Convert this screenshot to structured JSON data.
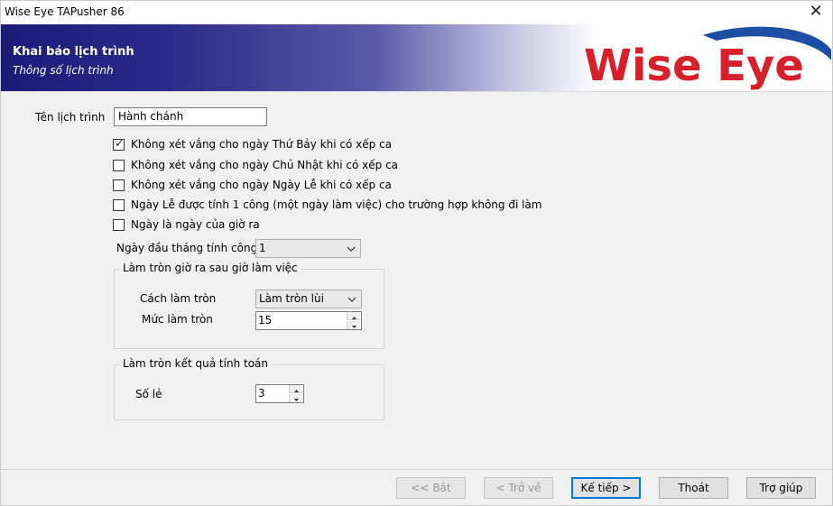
{
  "window": {
    "title": "Wise Eye TAPusher 86",
    "close_glyph": "✕"
  },
  "banner": {
    "title": "Khai báo lịch trình",
    "subtitle": "Thông số lịch trình",
    "logo_text": "Wise Eye",
    "logo_color": "#d8202a",
    "swoosh_color": "#1c4fa3"
  },
  "form": {
    "schedule_name_label": "Tên lịch trình",
    "schedule_name_value": "Hành chánh",
    "checkboxes": [
      {
        "label": "Không xét vắng cho ngày Thứ Bảy khi có xếp ca",
        "checked": true
      },
      {
        "label": "Không xét vắng cho ngày Chủ Nhật khi có xếp ca",
        "checked": false
      },
      {
        "label": "Không xét vắng cho ngày Ngày Lễ khi có xếp ca",
        "checked": false
      },
      {
        "label": "Ngày Lễ được tính 1 công (một ngày làm việc) cho trường hợp không đi làm",
        "checked": false
      },
      {
        "label": "Ngày là ngày của giờ ra",
        "checked": false
      }
    ],
    "first_day_label": "Ngày đầu tháng tính công",
    "first_day_value": "1",
    "round_out_group": {
      "legend": "Làm tròn giờ ra sau giờ làm việc",
      "method_label": "Cách làm tròn",
      "method_value": "Làm tròn lùi",
      "level_label": "Mức làm tròn",
      "level_value": "15"
    },
    "round_result_group": {
      "legend": "Làm tròn kết quả tính toán",
      "decimals_label": "Số lẻ",
      "decimals_value": "3"
    }
  },
  "footer": {
    "back": "<< Bắt",
    "prev": "< Trở về",
    "next": "Kế tiếp >",
    "exit": "Thoát",
    "help": "Trợ giúp"
  }
}
